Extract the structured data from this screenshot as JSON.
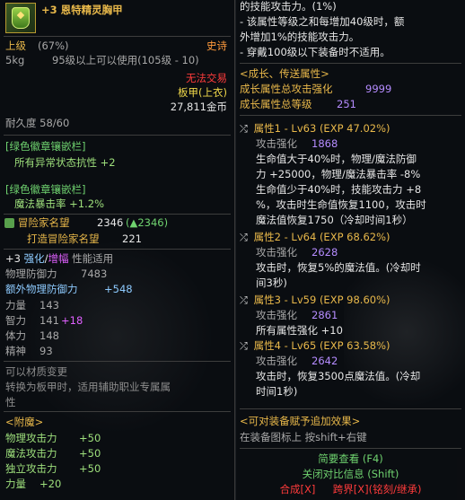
{
  "left": {
    "header": {
      "title": "+3 恩特精灵胸甲"
    },
    "grade": {
      "label": "上级",
      "percent": "(67%)",
      "rarity": "史诗"
    },
    "weight": "5kg",
    "level_req": "95级以上可以使用(105级 - 10)",
    "trade": "无法交易",
    "type": "板甲(上衣)",
    "price": "27,811金币",
    "durability": "耐久度 58/60",
    "emblem1": {
      "header": "[绿色徽章镶嵌栏]",
      "stat": "所有异常状态抗性 +2"
    },
    "emblem2": {
      "header": "[绿色徽章镶嵌栏]",
      "stat": "魔法暴击率 +1.2%"
    },
    "fame": {
      "label": "冒险家名望",
      "value": "2346",
      "up": "(▲2346)",
      "sub_label": "打造冒险家名望",
      "sub_value": "221"
    },
    "reinforce": {
      "prefix": "+3",
      "a": "强化",
      "sep": "/",
      "b": "增幅",
      "suffix": " 性能适用"
    },
    "stats": [
      {
        "label": "物理防御力",
        "value": "7483"
      },
      {
        "label": "额外物理防御力",
        "value": "+548"
      },
      {
        "label": "力量",
        "value": "143"
      },
      {
        "label": "智力",
        "value": "141",
        "bonus": "+18"
      },
      {
        "label": "体力",
        "value": "148"
      },
      {
        "label": "精神",
        "value": "93"
      }
    ],
    "material": [
      "可以材质变更",
      "转换为板甲时，适用辅助职业专属属",
      "性"
    ],
    "enchant_header": "<附魔>",
    "enchants": [
      {
        "label": "物理攻击力",
        "value": "+50"
      },
      {
        "label": "魔法攻击力",
        "value": "+50"
      },
      {
        "label": "独立攻击力",
        "value": "+50"
      },
      {
        "label": "力量",
        "value": "+20"
      }
    ]
  },
  "right": {
    "top_lines": [
      "的技能攻击力。(1%)",
      "- 该属性等级之和每增加40级时，额",
      "外增加1%的技能攻击力。",
      "- 穿戴100级以下装备时不适用。"
    ],
    "growth_header": "<成长、传送属性>",
    "growth_summary": [
      {
        "label": "成长属性总攻击强化",
        "value": "9999"
      },
      {
        "label": "成长属性总等级",
        "value": "251"
      }
    ],
    "attrs": [
      {
        "title": "属性1 - Lv63",
        "exp": "(EXP 47.02%)",
        "atk_label": "攻击强化",
        "atk_value": "1868",
        "lines": [
          "生命值大于40%时，物理/魔法防御",
          "力 +25000，物理/魔法暴击率 -8%",
          "生命值少于40%时，技能攻击力 +8",
          "%，攻击时生命值恢复1100，攻击时",
          "魔法值恢复1750（冷却时间1秒）"
        ]
      },
      {
        "title": "属性2 - Lv64",
        "exp": "(EXP 68.62%)",
        "atk_label": "攻击强化",
        "atk_value": "2628",
        "lines": [
          "攻击时，恢复5%的魔法值。(冷却时",
          "间3秒)"
        ]
      },
      {
        "title": "属性3 - Lv59",
        "exp": "(EXP 98.60%)",
        "atk_label": "攻击强化",
        "atk_value": "2861",
        "lines": [
          "所有属性强化 +10"
        ]
      },
      {
        "title": "属性4 - Lv65",
        "exp": "(EXP 63.58%)",
        "atk_label": "攻击强化",
        "atk_value": "2642",
        "lines": [
          "攻击时，恢复3500点魔法值。(冷却",
          "时间1秒)"
        ]
      }
    ],
    "hint_header": "<可对装备赋予追加效果>",
    "hint_text": "在装备图标上 按shift+右键",
    "footer": {
      "brief": "简要查看 (F4)",
      "close_compare": "关闭对比信息 (Shift)",
      "combine": "合成[X]",
      "cross": "跨界[X](铭刻/继承)"
    }
  },
  "colors": {
    "gold": "#e8b84a",
    "rarity": "#ff9a3c",
    "emblem_green": "#6fd26f",
    "value_blue": "#6fa8f0",
    "growth_purple": "#b58cff",
    "combine_red": "#ff3b3b",
    "bonus_pink": "#e060ff"
  }
}
